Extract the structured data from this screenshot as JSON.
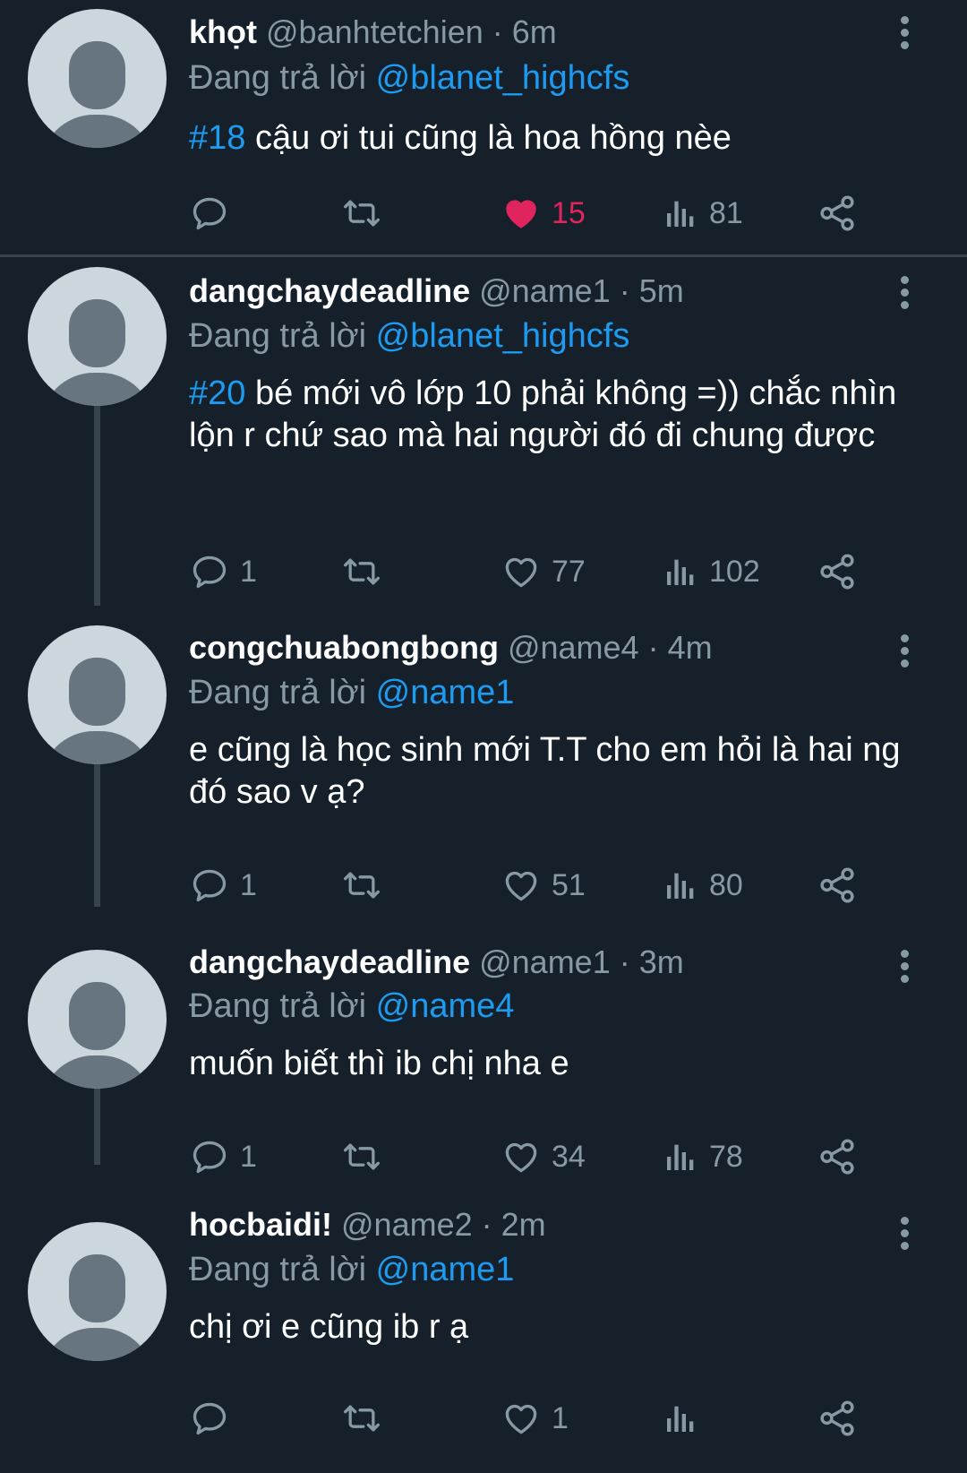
{
  "colors": {
    "background": "#15202b",
    "accent": "#1d9bf0",
    "like": "#e0245e",
    "muted": "#8899a6"
  },
  "reply_prefix": "Đang trả lời",
  "tweets": [
    {
      "display_name": "khọt",
      "handle": "@banhtetchien",
      "time": "· 6m",
      "replying_to": "@blanet_highcfs",
      "tag": "#18",
      "text": " cậu ơi tui cũng là hoa hồng nèe",
      "replies": "",
      "likes": "15",
      "liked": true,
      "views": "81"
    },
    {
      "display_name": "dangchaydeadline",
      "handle": "@name1",
      "time": "· 5m",
      "replying_to": "@blanet_highcfs",
      "tag": "#20",
      "text": " bé mới vô lớp 10 phải không =)) chắc nhìn lộn r chứ sao mà hai người đó đi chung được",
      "replies": "1",
      "likes": "77",
      "liked": false,
      "views": "102"
    },
    {
      "display_name": "congchuabongbong",
      "handle": "@name4",
      "time": "· 4m",
      "replying_to": "@name1",
      "tag": "",
      "text": "e cũng là học sinh mới T.T cho em hỏi là hai ng đó sao v ạ?",
      "replies": "1",
      "likes": "51",
      "liked": false,
      "views": "80"
    },
    {
      "display_name": "dangchaydeadline",
      "handle": "@name1",
      "time": "· 3m",
      "replying_to": "@name4",
      "tag": "",
      "text": "muốn biết thì ib chị nha e",
      "replies": "1",
      "likes": "34",
      "liked": false,
      "views": "78"
    },
    {
      "display_name": "hocbaidi!",
      "handle": "@name2",
      "time": "· 2m",
      "replying_to": "@name1",
      "tag": "",
      "text": "chị ơi e cũng ib r ạ",
      "replies": "",
      "likes": "1",
      "liked": false,
      "views": ""
    }
  ]
}
